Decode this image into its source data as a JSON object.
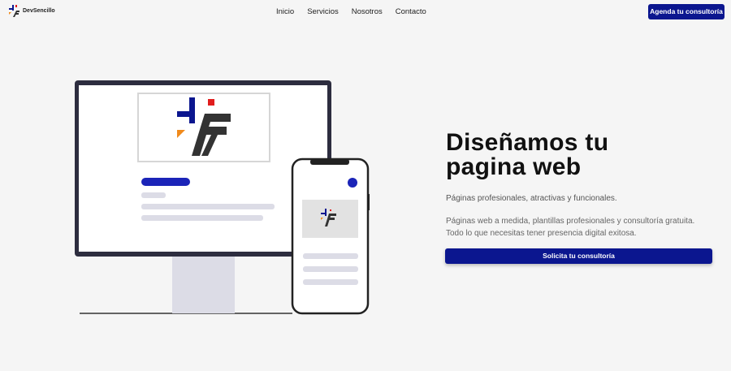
{
  "header": {
    "brand_name": "DevSencillo",
    "nav": [
      "Inicio",
      "Servicios",
      "Nosotros",
      "Contacto"
    ],
    "cta_label": "Agenda tu consultoría"
  },
  "hero": {
    "title_line1": "Diseñamos tu",
    "title_line2": "pagina web",
    "subtitle": "Páginas profesionales, atractivas y funcionales.",
    "description": "Páginas web a medida, plantillas profesionales y consultoría gratuita. Todo lo que necesitas tener presencia digital exitosa.",
    "cta_label": "Solicita tu consultoría"
  },
  "colors": {
    "primary": "#0b168f",
    "logo_red": "#e11d1d",
    "logo_orange": "#f08a1c",
    "logo_dark": "#333333",
    "background": "#f5f5f5"
  },
  "icons": {
    "brand": "devsencillo-logo-icon",
    "monitor": "monitor-illustration",
    "phone": "phone-illustration"
  }
}
